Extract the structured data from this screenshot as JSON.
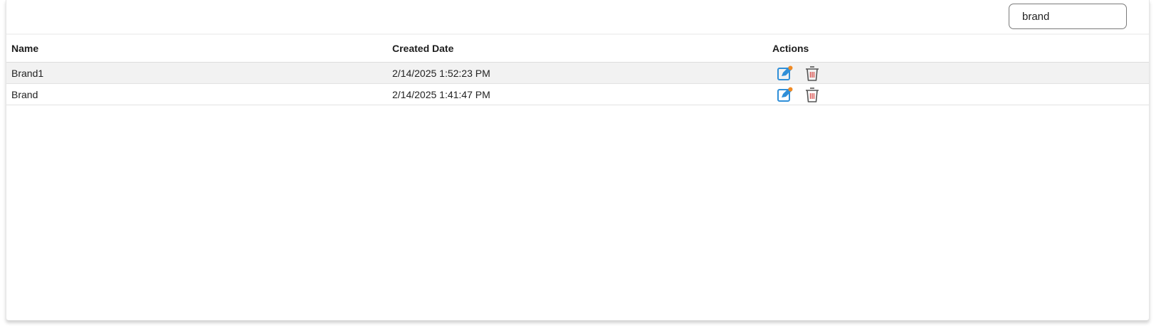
{
  "search": {
    "value": "brand",
    "placeholder": ""
  },
  "table": {
    "columns": [
      "Name",
      "Created Date",
      "Actions"
    ],
    "rows": [
      {
        "name": "Brand1",
        "created": "2/14/2025 1:52:23 PM",
        "actions": [
          "edit-icon",
          "trash-icon"
        ]
      },
      {
        "name": "Brand",
        "created": "2/14/2025 1:41:47 PM",
        "actions": [
          "edit-icon",
          "trash-icon"
        ]
      }
    ]
  },
  "colors": {
    "edit_icon": "#2f8fd8",
    "edit_pencil": "#f08a24",
    "trash_icon": "#555555",
    "trash_lines": "#d9534f",
    "row_shade": "#f2f2f2"
  }
}
